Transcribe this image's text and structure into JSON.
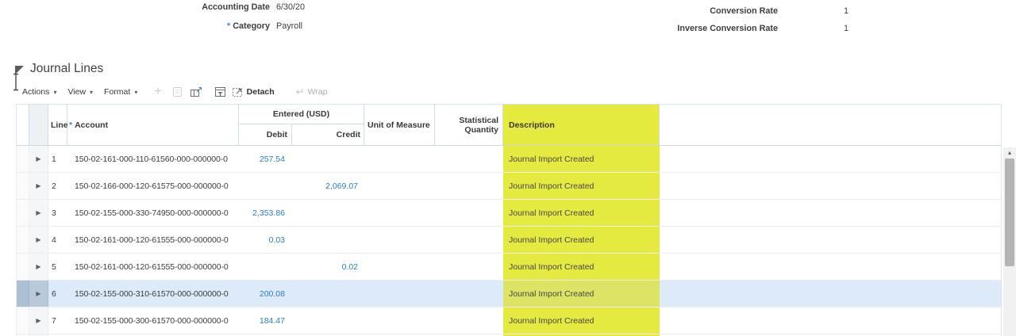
{
  "header_fields": {
    "accounting_date": {
      "label": "Accounting Date",
      "value": "6/30/20"
    },
    "category": {
      "required_marker": "*",
      "label": "Category",
      "value": "Payroll"
    },
    "conversion_rate": {
      "label": "Conversion Rate",
      "value": "1"
    },
    "inverse_conversion_rate": {
      "label": "Inverse Conversion Rate",
      "value": "1"
    }
  },
  "section": {
    "title": "Journal Lines"
  },
  "toolbar": {
    "menus": [
      {
        "label": "Actions"
      },
      {
        "label": "View"
      },
      {
        "label": "Format"
      }
    ],
    "detach_label": "Detach",
    "wrap_label": "Wrap"
  },
  "icons": {
    "section_collapse": "triangle-collapse",
    "menu_arrow": "▾",
    "plus": "+",
    "expand_row": "▶",
    "wrap": "↵",
    "scroll_up": "▴"
  },
  "table": {
    "columns": {
      "line": "Line",
      "account_required_marker": "*",
      "account": "Account",
      "entered_group": "Entered (USD)",
      "debit": "Debit",
      "credit": "Credit",
      "unit_of_measure": "Unit of Measure",
      "statistical_quantity": "Statistical Quantity",
      "description": "Description"
    },
    "selected_row_line": "6",
    "rows": [
      {
        "line": "1",
        "account": "150-02-161-000-110-61560-000-000000-0",
        "debit": "257.54",
        "credit": "",
        "description": "Journal Import Created"
      },
      {
        "line": "2",
        "account": "150-02-166-000-120-61575-000-000000-0",
        "debit": "",
        "credit": "2,069.07",
        "description": "Journal Import Created"
      },
      {
        "line": "3",
        "account": "150-02-155-000-330-74950-000-000000-0",
        "debit": "2,353.86",
        "credit": "",
        "description": "Journal Import Created"
      },
      {
        "line": "4",
        "account": "150-02-161-000-120-61555-000-000000-0",
        "debit": "0.03",
        "credit": "",
        "description": "Journal Import Created"
      },
      {
        "line": "5",
        "account": "150-02-161-000-120-61555-000-000000-0",
        "debit": "",
        "credit": "0.02",
        "description": "Journal Import Created"
      },
      {
        "line": "6",
        "account": "150-02-155-000-310-61570-000-000000-0",
        "debit": "200.08",
        "credit": "",
        "description": "Journal Import Created"
      },
      {
        "line": "7",
        "account": "150-02-155-000-300-61570-000-000000-0",
        "debit": "184.47",
        "credit": "",
        "description": "Journal Import Created"
      }
    ]
  },
  "colors": {
    "column_highlight": "#e5ea40",
    "selected_row": "#dceaf9",
    "amount_link": "#2d7dc1",
    "required_marker": "#4a7fbe"
  }
}
